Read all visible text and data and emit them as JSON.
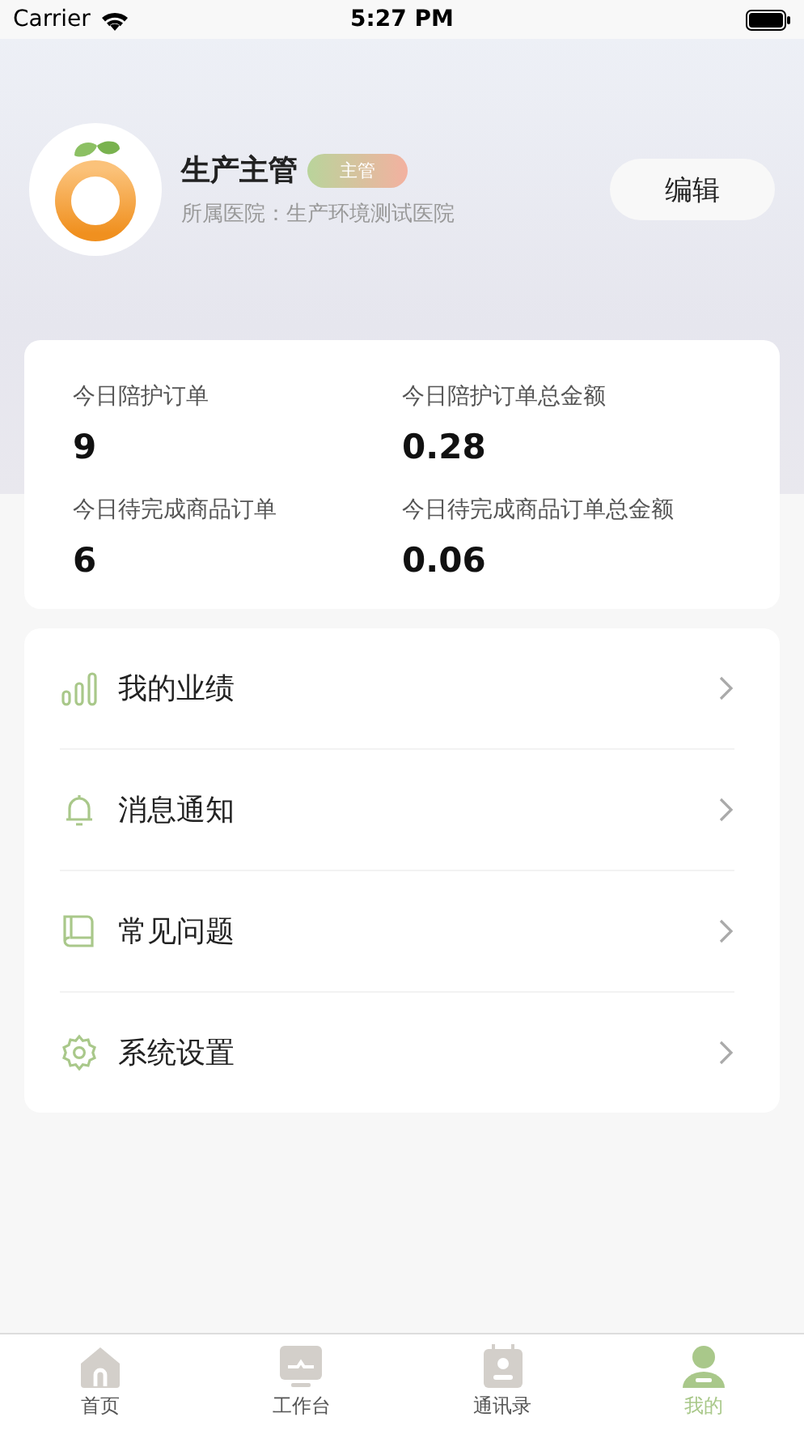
{
  "status_bar": {
    "carrier": "Carrier",
    "time": "5:27 PM"
  },
  "profile": {
    "name": "生产主管",
    "role_badge": "主管",
    "hospital": "所属医院：生产环境测试医院",
    "edit_button": "编辑"
  },
  "stats": [
    {
      "label": "今日陪护订单",
      "value": "9"
    },
    {
      "label": "今日陪护订单总金额",
      "value": "0.28"
    },
    {
      "label": "今日待完成商品订单",
      "value": "6"
    },
    {
      "label": "今日待完成商品订单总金额",
      "value": "0.06"
    }
  ],
  "menu": [
    {
      "kind": "chart",
      "label": "我的业绩"
    },
    {
      "kind": "bell",
      "label": "消息通知"
    },
    {
      "kind": "book",
      "label": "常见问题"
    },
    {
      "kind": "gear",
      "label": "系统设置"
    }
  ],
  "tab_bar": [
    {
      "kind": "home",
      "label": "首页",
      "selected": false
    },
    {
      "kind": "monitor",
      "label": "工作台",
      "selected": false
    },
    {
      "kind": "contacts",
      "label": "通讯录",
      "selected": false
    },
    {
      "kind": "person",
      "label": "我的",
      "selected": true
    }
  ]
}
